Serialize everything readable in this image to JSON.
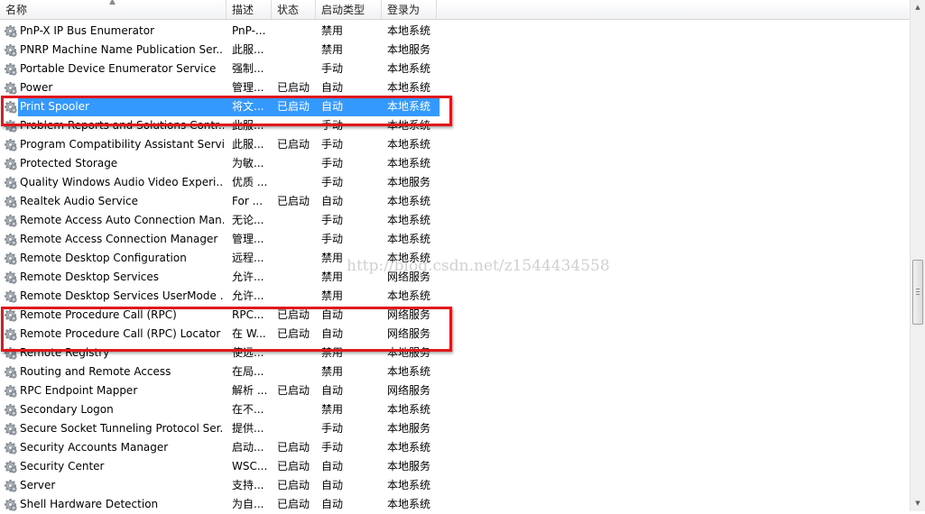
{
  "columns": {
    "name": "名称",
    "desc": "描述",
    "status": "状态",
    "startup": "启动类型",
    "logon": "登录为"
  },
  "services": [
    {
      "name": "PnP-X IP Bus Enumerator",
      "desc": "PnP-...",
      "status": "",
      "startup": "禁用",
      "logon": "本地系统"
    },
    {
      "name": "PNRP Machine Name Publication Ser...",
      "desc": "此服...",
      "status": "",
      "startup": "禁用",
      "logon": "本地服务"
    },
    {
      "name": "Portable Device Enumerator Service",
      "desc": "强制...",
      "status": "",
      "startup": "手动",
      "logon": "本地系统"
    },
    {
      "name": "Power",
      "desc": "管理...",
      "status": "已启动",
      "startup": "自动",
      "logon": "本地系统"
    },
    {
      "name": "Print Spooler",
      "desc": "将文...",
      "status": "已启动",
      "startup": "自动",
      "logon": "本地系统"
    },
    {
      "name": "Problem Reports and Solutions Contr...",
      "desc": "此服...",
      "status": "",
      "startup": "手动",
      "logon": "本地系统"
    },
    {
      "name": "Program Compatibility Assistant Servi...",
      "desc": "此服...",
      "status": "已启动",
      "startup": "手动",
      "logon": "本地系统"
    },
    {
      "name": "Protected Storage",
      "desc": "为敏...",
      "status": "",
      "startup": "手动",
      "logon": "本地系统"
    },
    {
      "name": "Quality Windows Audio Video Experi...",
      "desc": "优质 ...",
      "status": "",
      "startup": "手动",
      "logon": "本地服务"
    },
    {
      "name": "Realtek Audio Service",
      "desc": "For ...",
      "status": "已启动",
      "startup": "自动",
      "logon": "本地系统"
    },
    {
      "name": "Remote Access Auto Connection Man...",
      "desc": "无论...",
      "status": "",
      "startup": "手动",
      "logon": "本地系统"
    },
    {
      "name": "Remote Access Connection Manager",
      "desc": "管理...",
      "status": "",
      "startup": "手动",
      "logon": "本地系统"
    },
    {
      "name": "Remote Desktop Configuration",
      "desc": "远程...",
      "status": "",
      "startup": "禁用",
      "logon": "本地系统"
    },
    {
      "name": "Remote Desktop Services",
      "desc": "允许...",
      "status": "",
      "startup": "禁用",
      "logon": "网络服务"
    },
    {
      "name": "Remote Desktop Services UserMode ...",
      "desc": "允许...",
      "status": "",
      "startup": "禁用",
      "logon": "本地系统"
    },
    {
      "name": "Remote Procedure Call (RPC)",
      "desc": "RPC...",
      "status": "已启动",
      "startup": "自动",
      "logon": "网络服务"
    },
    {
      "name": "Remote Procedure Call (RPC) Locator",
      "desc": "在 W...",
      "status": "已启动",
      "startup": "自动",
      "logon": "网络服务"
    },
    {
      "name": "Remote Registry",
      "desc": "使远...",
      "status": "",
      "startup": "禁用",
      "logon": "本地服务"
    },
    {
      "name": "Routing and Remote Access",
      "desc": "在局...",
      "status": "",
      "startup": "禁用",
      "logon": "本地系统"
    },
    {
      "name": "RPC Endpoint Mapper",
      "desc": "解析 ...",
      "status": "已启动",
      "startup": "自动",
      "logon": "网络服务"
    },
    {
      "name": "Secondary Logon",
      "desc": "在不...",
      "status": "",
      "startup": "禁用",
      "logon": "本地系统"
    },
    {
      "name": "Secure Socket Tunneling Protocol Ser...",
      "desc": "提供...",
      "status": "",
      "startup": "手动",
      "logon": "本地服务"
    },
    {
      "name": "Security Accounts Manager",
      "desc": "启动...",
      "status": "已启动",
      "startup": "手动",
      "logon": "本地系统"
    },
    {
      "name": "Security Center",
      "desc": "WSC...",
      "status": "已启动",
      "startup": "自动",
      "logon": "本地服务"
    },
    {
      "name": "Server",
      "desc": "支持...",
      "status": "已启动",
      "startup": "自动",
      "logon": "本地系统"
    },
    {
      "name": "Shell Hardware Detection",
      "desc": "为自...",
      "status": "已启动",
      "startup": "自动",
      "logon": "本地系统"
    }
  ],
  "selected_service": "Print Spooler",
  "highlighted_services": [
    "Print Spooler",
    "Remote Procedure Call (RPC)",
    "Remote Procedure Call (RPC) Locator"
  ],
  "watermark": "http://blog.csdn.net/z1544434558",
  "colors": {
    "selection": "#3399ff",
    "highlight_box": "#e0181b"
  },
  "icons": {
    "service": "gear-icon",
    "sort": "sort-ascending-icon"
  }
}
